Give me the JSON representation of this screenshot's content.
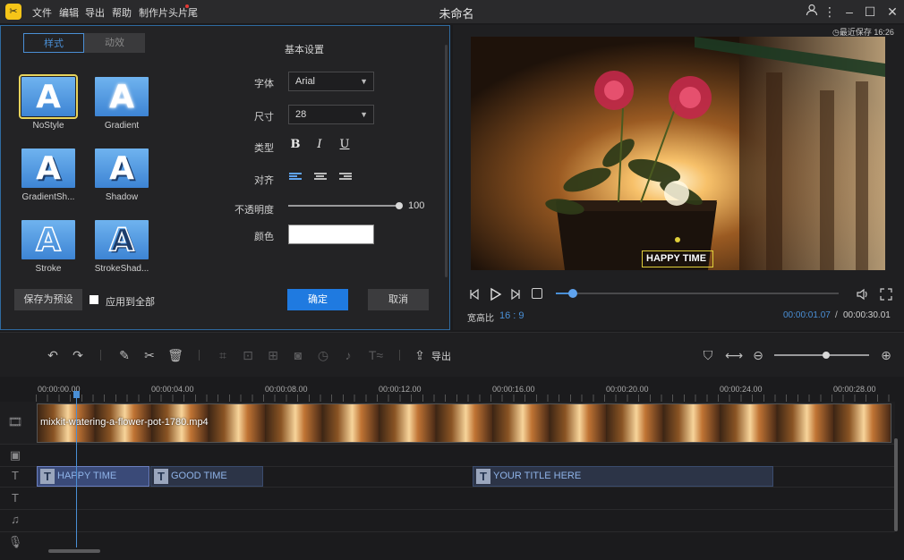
{
  "app": {
    "title": "未命名",
    "logo": "app-logo"
  },
  "menu": [
    "文件",
    "编辑",
    "导出",
    "帮助",
    "制作片头片尾"
  ],
  "window_controls": [
    "user-icon",
    "more-icon",
    "minimize-icon",
    "maximize-icon",
    "close-icon"
  ],
  "text_panel": {
    "tabs": [
      "样式",
      "动效"
    ],
    "presets": [
      {
        "label": "NoStyle"
      },
      {
        "label": "Gradient"
      },
      {
        "label": "GradientSh..."
      },
      {
        "label": "Shadow"
      },
      {
        "label": "Stroke"
      },
      {
        "label": "StrokeShad..."
      }
    ],
    "section_title": "基本设置",
    "font_label": "字体",
    "font_value": "Arial",
    "size_label": "尺寸",
    "size_value": "28",
    "type_label": "类型",
    "type_buttons": [
      "B",
      "I",
      "U"
    ],
    "align_label": "对齐",
    "opacity_label": "不透明度",
    "opacity_value": "100",
    "opacity_fraction": 1.0,
    "color_label": "颜色",
    "color_value": "#ffffff",
    "save_preset": "保存为预设",
    "apply_all": "应用到全部",
    "ok": "确定",
    "cancel": "取消"
  },
  "preview": {
    "last_saved": "最近保存 16:26",
    "overlay_text": "HAPPY TIME",
    "aspect_label": "宽高比",
    "aspect_value": "16 : 9",
    "current_time": "00:00:01.07",
    "separator": "/",
    "total_time": "00:00:30.01",
    "progress_fraction": 0.06
  },
  "toolbar": {
    "export_label": "导出",
    "zoom_fraction": 0.55
  },
  "timeline": {
    "ticks": [
      "00:00:00.00",
      "00:00:04.00",
      "00:00:08.00",
      "00:00:12.00",
      "00:00:16.00",
      "00:00:20.00",
      "00:00:24.00",
      "00:00:28.00"
    ],
    "video_clip": "mixkit-watering-a-flower-pot-1780.mp4",
    "text_clips": [
      "HAPPY TIME",
      "GOOD TIME",
      "YOUR TITLE HERE"
    ]
  },
  "colors": {
    "accent": "#4a8fd6",
    "primary_button": "#1f7ae0",
    "panel_border": "#2f6aa0",
    "selected_outline": "#e8d45c"
  }
}
